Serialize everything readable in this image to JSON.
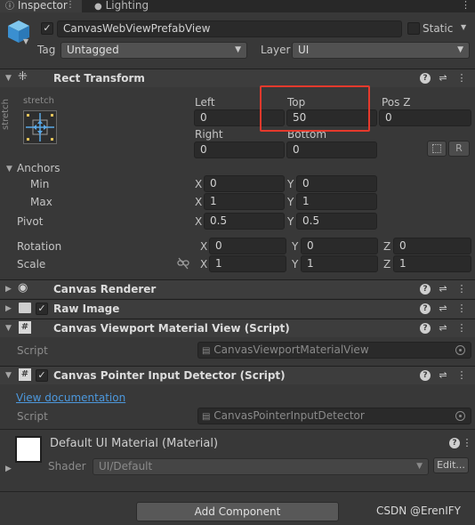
{
  "tabs": {
    "inspector": "Inspector",
    "lighting": "Lighting"
  },
  "gameobject": {
    "name": "CanvasWebViewPrefabView",
    "static_label": "Static",
    "tag_label": "Tag",
    "tag_value": "Untagged",
    "layer_label": "Layer",
    "layer_value": "UI"
  },
  "rect_transform": {
    "title": "Rect Transform",
    "anchor_preset_h": "stretch",
    "anchor_preset_v": "stretch",
    "left_label": "Left",
    "left_value": "0",
    "top_label": "Top",
    "top_value": "50",
    "posz_label": "Pos Z",
    "posz_value": "0",
    "right_label": "Right",
    "right_value": "0",
    "bottom_label": "Bottom",
    "bottom_value": "0",
    "r_button": "R",
    "anchors_label": "Anchors",
    "min_label": "Min",
    "min_x": "0",
    "min_y": "0",
    "max_label": "Max",
    "max_x": "1",
    "max_y": "1",
    "pivot_label": "Pivot",
    "pivot_x": "0.5",
    "pivot_y": "0.5",
    "rotation_label": "Rotation",
    "rot_x": "0",
    "rot_y": "0",
    "rot_z": "0",
    "scale_label": "Scale",
    "scale_x": "1",
    "scale_y": "1",
    "scale_z": "1",
    "x_axis": "X",
    "y_axis": "Y",
    "z_axis": "Z"
  },
  "components": {
    "canvas_renderer": "Canvas Renderer",
    "raw_image": "Raw Image",
    "viewport_script": "Canvas Viewport Material View (Script)",
    "script_label": "Script",
    "viewport_script_value": "CanvasViewportMaterialView",
    "pointer_script": "Canvas Pointer Input Detector (Script)",
    "view_documentation": "View documentation",
    "pointer_script_value": "CanvasPointerInputDetector"
  },
  "material": {
    "title": "Default UI Material (Material)",
    "shader_label": "Shader",
    "shader_value": "UI/Default",
    "edit_button": "Edit..."
  },
  "add_component": "Add Component",
  "watermark": "CSDN @ErenIFY"
}
